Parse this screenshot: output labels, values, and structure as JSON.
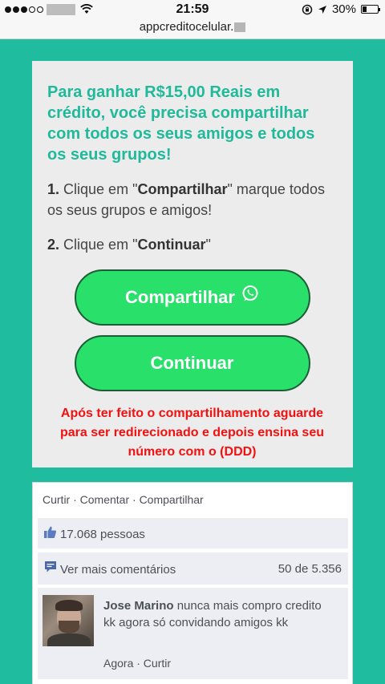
{
  "status_bar": {
    "time": "21:59",
    "battery_text": "30%",
    "battery_level": 0.3
  },
  "url_bar": {
    "url": "appcreditocelular."
  },
  "card": {
    "headline": "Para ganhar R$15,00 Reais em crédito, você precisa compartilhar com todos os seus amigos e todos os seus grupos!",
    "step1_number": "1.",
    "step1_prefix": "Clique em \"",
    "step1_bold": "Compartilhar",
    "step1_suffix": "\" marque todos os seus grupos e amigos!",
    "step2_number": "2.",
    "step2_prefix": "Clique em \"",
    "step2_bold": "Continuar",
    "step2_suffix": "\"",
    "share_button": "Compartilhar",
    "continue_button": "Continuar",
    "warning": "Após ter feito o compartilhamento aguarde para ser redirecionado e depois ensina seu número com o (DDD)"
  },
  "facebook": {
    "actions": "Curtir · Comentar · Compartilhar",
    "likes": "17.068 pessoas",
    "more_comments": "Ver mais comentários",
    "comment_count": "50 de 5.356",
    "comment": {
      "name": "Jose Marino",
      "text": " nunca mais compro credito kk agora só convidando amigos kk",
      "meta": "Agora · Curtir"
    }
  },
  "colors": {
    "background": "#20bca0",
    "headline": "#20b99a",
    "button": "#29e06a",
    "warning": "#f21010"
  }
}
